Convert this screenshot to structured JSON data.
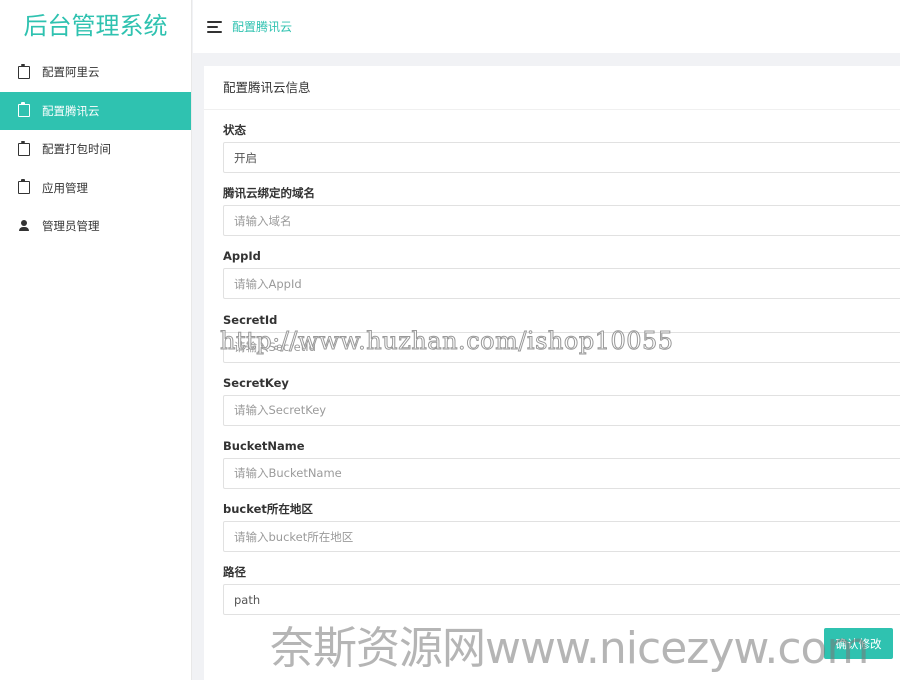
{
  "app": {
    "title": "后台管理系统"
  },
  "colors": {
    "accent": "#2fc2b0",
    "text": "#333333",
    "background": "#f1f2f5"
  },
  "sidebar": {
    "items": [
      {
        "label": "配置阿里云",
        "icon": "clipboard-icon",
        "active": false
      },
      {
        "label": "配置腾讯云",
        "icon": "clipboard-icon",
        "active": true
      },
      {
        "label": "配置打包时间",
        "icon": "clipboard-icon",
        "active": false
      },
      {
        "label": "应用管理",
        "icon": "clipboard-icon",
        "active": false
      },
      {
        "label": "管理员管理",
        "icon": "user-icon",
        "active": false
      }
    ]
  },
  "header": {
    "menu_icon": "hamburger-icon",
    "breadcrumb": "配置腾讯云"
  },
  "panel": {
    "title": "配置腾讯云信息"
  },
  "form": {
    "fields": [
      {
        "label": "状态",
        "value": "开启",
        "placeholder": ""
      },
      {
        "label": "腾讯云绑定的域名",
        "value": "",
        "placeholder": "请输入域名"
      },
      {
        "label": "AppId",
        "value": "",
        "placeholder": "请输入AppId"
      },
      {
        "label": "SecretId",
        "value": "",
        "placeholder": "请输入SecretId"
      },
      {
        "label": "SecretKey",
        "value": "",
        "placeholder": "请输入SecretKey"
      },
      {
        "label": "BucketName",
        "value": "",
        "placeholder": "请输入BucketName"
      },
      {
        "label": "bucket所在地区",
        "value": "",
        "placeholder": "请输入bucket所在地区"
      },
      {
        "label": "路径",
        "value": "path",
        "placeholder": ""
      }
    ],
    "submit_label": "确认修改"
  },
  "watermarks": {
    "url": "http://www.huzhan.com/ishop10055",
    "site": "奈斯资源网www.nicezyw.com"
  }
}
